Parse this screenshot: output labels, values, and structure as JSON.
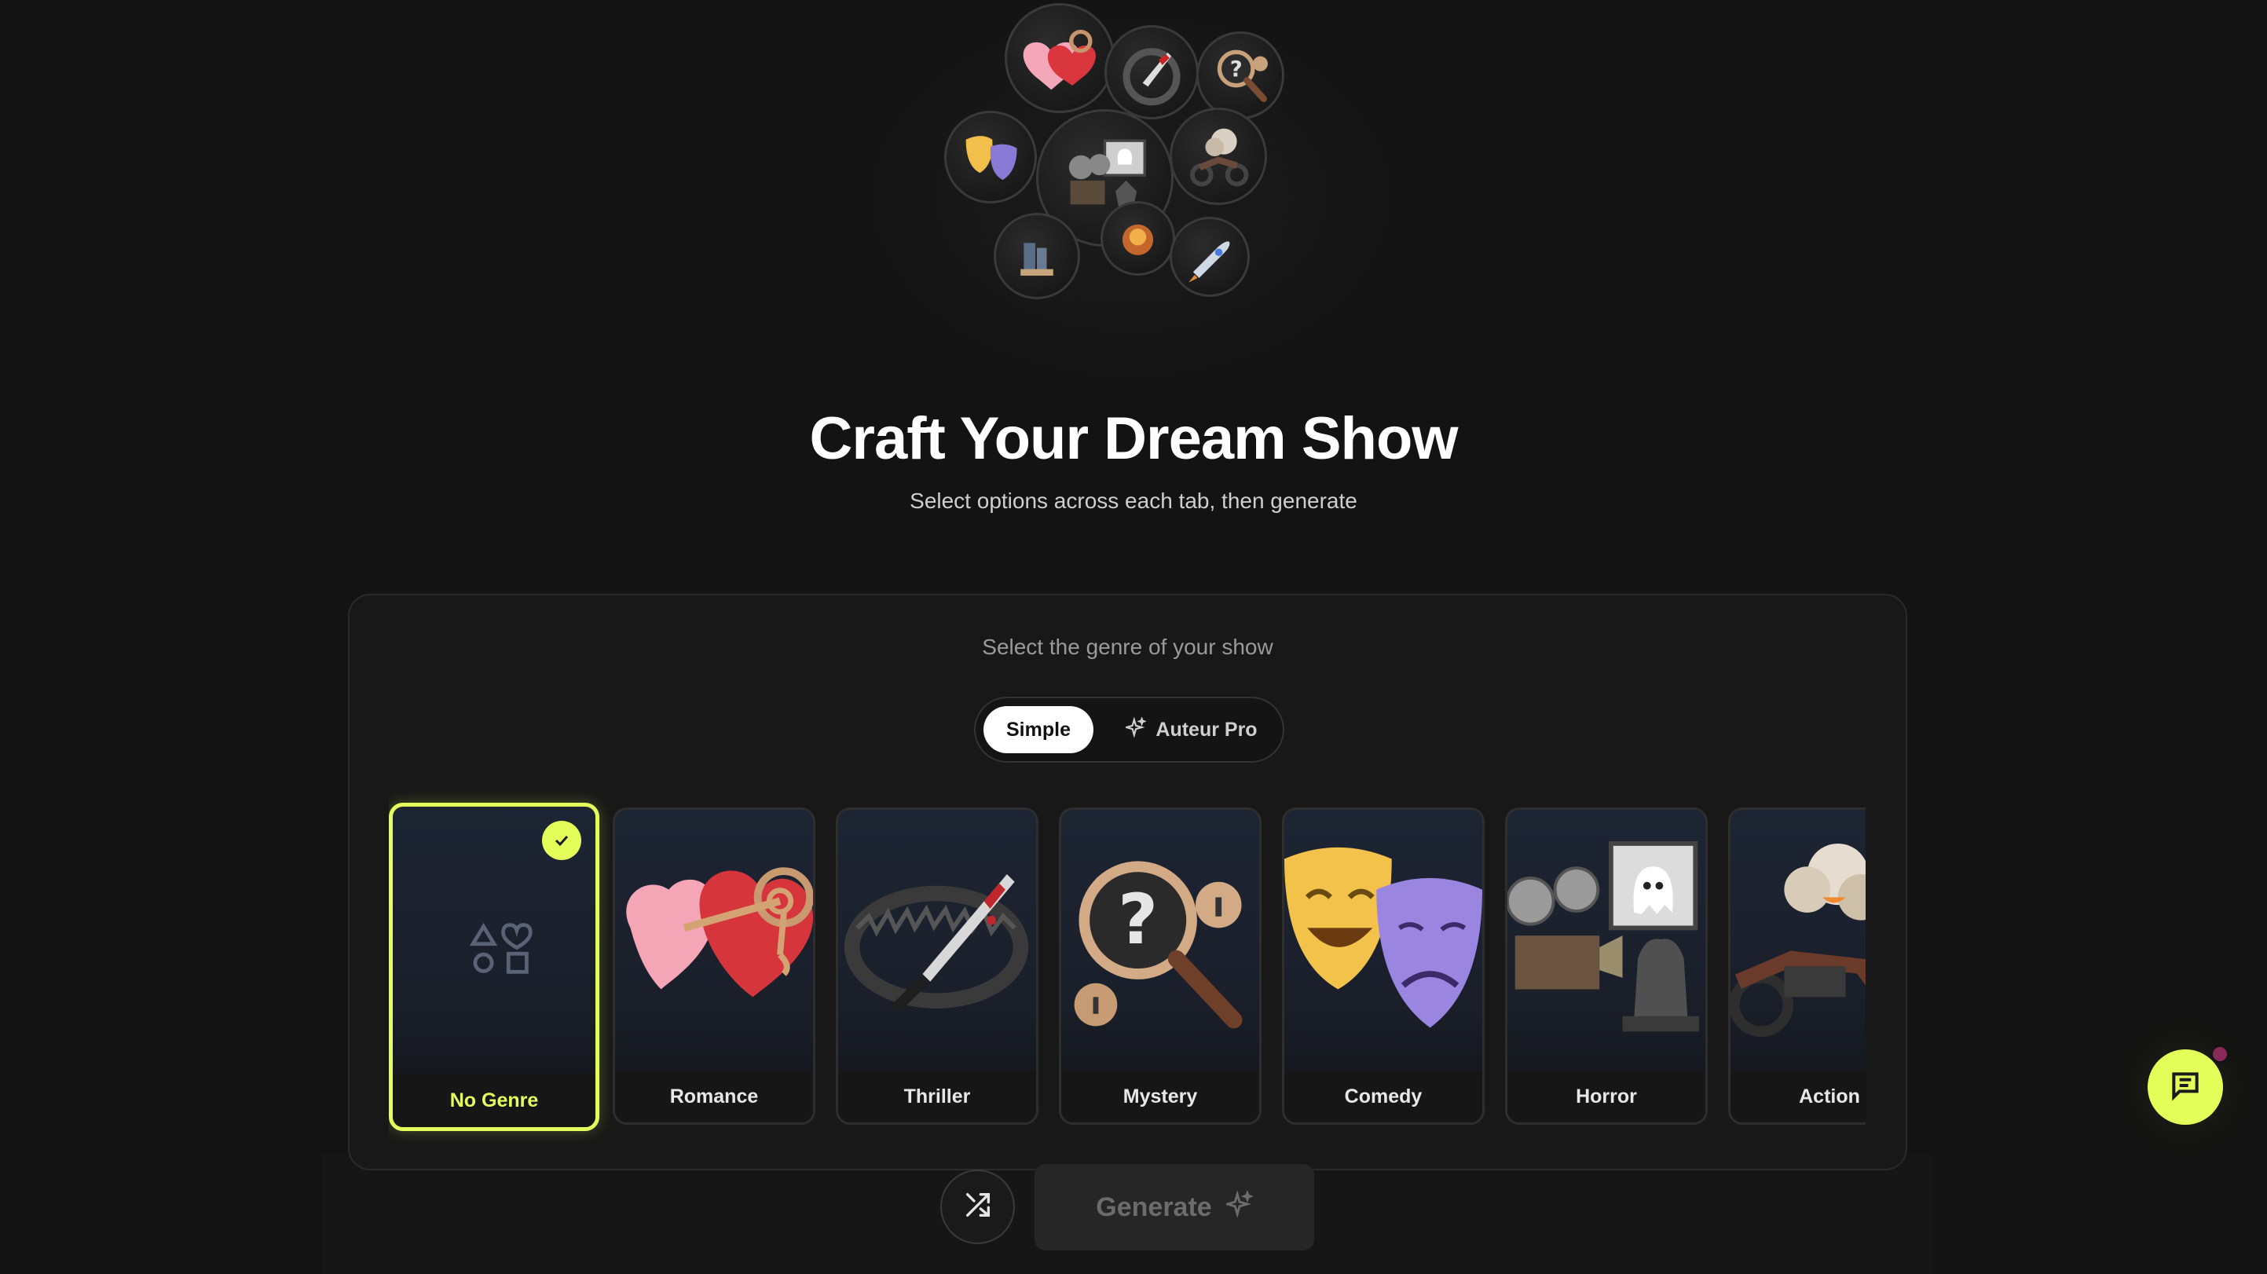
{
  "hero": {
    "title": "Craft Your Dream Show",
    "subtitle": "Select options across each tab, then generate"
  },
  "panel": {
    "prompt": "Select the genre of your show",
    "modes": [
      {
        "label": "Simple",
        "active": true
      },
      {
        "label": "Auteur Pro",
        "active": false,
        "icon": "sparkle-icon"
      }
    ]
  },
  "genres": [
    {
      "label": "No Genre",
      "selected": true,
      "icon": "shapes-icon"
    },
    {
      "label": "Romance",
      "selected": false,
      "icon": "heart-lock-icon"
    },
    {
      "label": "Thriller",
      "selected": false,
      "icon": "bear-trap-knife-icon"
    },
    {
      "label": "Mystery",
      "selected": false,
      "icon": "magnifier-question-icon"
    },
    {
      "label": "Comedy",
      "selected": false,
      "icon": "theater-masks-icon"
    },
    {
      "label": "Horror",
      "selected": false,
      "icon": "projector-ghost-icon"
    },
    {
      "label": "Action",
      "selected": false,
      "icon": "motorcycle-explosion-icon"
    }
  ],
  "actions": {
    "shuffle_icon": "shuffle-icon",
    "generate_label": "Generate",
    "chat_icon": "chat-icon"
  },
  "colors": {
    "accent": "#e4ff5a",
    "background": "#131313",
    "panel": "#181818",
    "notification": "#8b2a5a"
  }
}
